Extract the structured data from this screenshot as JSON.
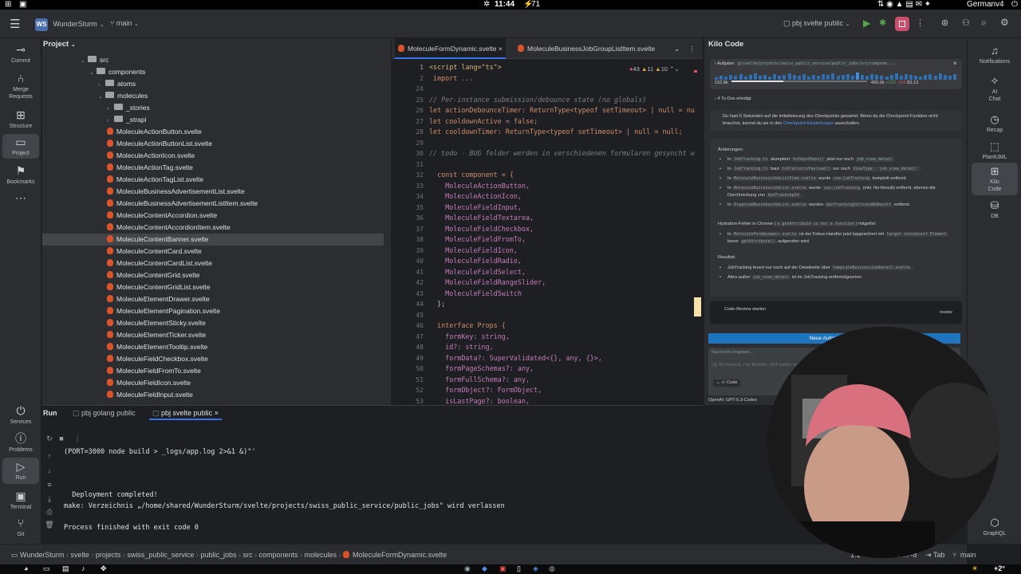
{
  "system_bar": {
    "time": "11:44",
    "battery": "71",
    "keyboard": "German",
    "input_version": "v4"
  },
  "header": {
    "project_tile": "WS",
    "project_name": "WunderSturm",
    "branch": "main",
    "run_config": "pbj svelte public"
  },
  "left_strip": [
    {
      "label": "Commit",
      "icon": "commit-icon"
    },
    {
      "label": "Merge Requests",
      "icon": "merge-request-icon"
    },
    {
      "label": "Structure",
      "icon": "structure-icon"
    },
    {
      "label": "Project",
      "icon": "folder-icon"
    },
    {
      "label": "Bookmarks",
      "icon": "bookmark-icon"
    }
  ],
  "left_bottom_strip": [
    {
      "label": "Services",
      "icon": "services-icon"
    },
    {
      "label": "Problems",
      "icon": "problems-icon"
    },
    {
      "label": "Run",
      "icon": "run-icon"
    },
    {
      "label": "Terminal",
      "icon": "terminal-icon"
    },
    {
      "label": "Git",
      "icon": "git-icon"
    }
  ],
  "project_panel": {
    "title": "Project",
    "tree": [
      {
        "label": "src",
        "type": "folder",
        "depth": 0,
        "expanded": true
      },
      {
        "label": "components",
        "type": "folder",
        "depth": 1,
        "expanded": true
      },
      {
        "label": "atoms",
        "type": "folder",
        "depth": 2,
        "expanded": false
      },
      {
        "label": "molecules",
        "type": "folder",
        "depth": 2,
        "expanded": true
      },
      {
        "label": "_stories",
        "type": "folder",
        "depth": 3,
        "expanded": false
      },
      {
        "label": "_strapi",
        "type": "folder",
        "depth": 3,
        "expanded": false
      },
      {
        "label": "MoleculeActionButton.svelte",
        "type": "file",
        "depth": 3
      },
      {
        "label": "MoleculeActionButtonList.svelte",
        "type": "file",
        "depth": 3
      },
      {
        "label": "MoleculeActionIcon.svelte",
        "type": "file",
        "depth": 3
      },
      {
        "label": "MoleculeActionTag.svelte",
        "type": "file",
        "depth": 3
      },
      {
        "label": "MoleculeActionTagList.svelte",
        "type": "file",
        "depth": 3
      },
      {
        "label": "MoleculeBusinessAdvertisementList.svelte",
        "type": "file",
        "depth": 3
      },
      {
        "label": "MoleculeBusinessAdvertisementListItem.svelte",
        "type": "file",
        "depth": 3
      },
      {
        "label": "MoleculeContentAccordion.svelte",
        "type": "file",
        "depth": 3
      },
      {
        "label": "MoleculeContentAccordionItem.svelte",
        "type": "file",
        "depth": 3
      },
      {
        "label": "MoleculeContentBanner.svelte",
        "type": "file",
        "depth": 3,
        "selected": true
      },
      {
        "label": "MoleculeContentCard.svelte",
        "type": "file",
        "depth": 3
      },
      {
        "label": "MoleculeContentCardList.svelte",
        "type": "file",
        "depth": 3
      },
      {
        "label": "MoleculeContentGrid.svelte",
        "type": "file",
        "depth": 3
      },
      {
        "label": "MoleculeContentGridList.svelte",
        "type": "file",
        "depth": 3
      },
      {
        "label": "MoleculeElementDrawer.svelte",
        "type": "file",
        "depth": 3
      },
      {
        "label": "MoleculeElementPagination.svelte",
        "type": "file",
        "depth": 3
      },
      {
        "label": "MoleculeElementSticky.svelte",
        "type": "file",
        "depth": 3
      },
      {
        "label": "MoleculeElementTicker.svelte",
        "type": "file",
        "depth": 3
      },
      {
        "label": "MoleculeElementTooltip.svelte",
        "type": "file",
        "depth": 3
      },
      {
        "label": "MoleculeFieldCheckbox.svelte",
        "type": "file",
        "depth": 3
      },
      {
        "label": "MoleculeFieldFromTo.svelte",
        "type": "file",
        "depth": 3
      },
      {
        "label": "MoleculeFieldIcon.svelte",
        "type": "file",
        "depth": 3
      },
      {
        "label": "MoleculeFieldInput.svelte",
        "type": "file",
        "depth": 3
      }
    ]
  },
  "editor": {
    "tabs": [
      {
        "label": "MoleculeFormDynamic.svelte",
        "active": true
      },
      {
        "label": "MoleculeBusinessJobGroupListItem.svelte",
        "active": false
      }
    ],
    "inspections": {
      "errors": "43",
      "warnings": "11",
      "weak": "10"
    },
    "lines": [
      {
        "n": "1",
        "text": "<script lang=\"ts\">"
      },
      {
        "n": "2",
        "text": " import ..."
      },
      {
        "n": "24",
        "text": ""
      },
      {
        "n": "25",
        "text": "// Per-instance submission/debounce state (no globals)"
      },
      {
        "n": "26",
        "text": "let actionDebounceTimer: ReturnType<typeof setTimeout> | null = null"
      },
      {
        "n": "27",
        "text": "let cooldownActive = false;"
      },
      {
        "n": "28",
        "text": "let cooldownTimer: ReturnType<typeof setTimeout> | null = null;"
      },
      {
        "n": "29",
        "text": ""
      },
      {
        "n": "30",
        "text": "// todo - BUG felder werden in verschiedenen formularen gesyncht wenn"
      },
      {
        "n": "31",
        "text": ""
      },
      {
        "n": "32",
        "text": "  const component = {"
      },
      {
        "n": "33",
        "text": "    MoleculeActionButton,"
      },
      {
        "n": "34",
        "text": "    MoleculeActionIcon,"
      },
      {
        "n": "35",
        "text": "    MoleculeFieldInput,"
      },
      {
        "n": "36",
        "text": "    MoleculeFieldTextarea,"
      },
      {
        "n": "37",
        "text": "    MoleculeFieldCheckbox,"
      },
      {
        "n": "38",
        "text": "    MoleculeFieldFromTo,"
      },
      {
        "n": "39",
        "text": "    MoleculeFieldIcon,"
      },
      {
        "n": "40",
        "text": "    MoleculeFieldRadio,"
      },
      {
        "n": "41",
        "text": "    MoleculeFieldSelect,"
      },
      {
        "n": "42",
        "text": "    MoleculeFieldRangeSlider,"
      },
      {
        "n": "43",
        "text": "    MoleculeFieldSwitch"
      },
      {
        "n": "44",
        "text": "  };"
      },
      {
        "n": "45",
        "text": ""
      },
      {
        "n": "46",
        "text": "  interface Props {"
      },
      {
        "n": "47",
        "text": "    formKey: string,"
      },
      {
        "n": "48",
        "text": "    id?: string,"
      },
      {
        "n": "49",
        "text": "    formData?: SuperValidated<{}, any, {}>,"
      },
      {
        "n": "50",
        "text": "    formPageSchemas?: any,"
      },
      {
        "n": "51",
        "text": "    formFullSchema?: any,"
      },
      {
        "n": "52",
        "text": "    formObject?: FormObject,"
      },
      {
        "n": "53",
        "text": "    isLastPage?: boolean,"
      }
    ]
  },
  "kilo": {
    "title": "Kilo Code",
    "task_label": "Aufgabe:",
    "task_path": "@/svelte/projects/swiss_public_service/public_jobs/src/compone...",
    "stats": {
      "left": "152.8k",
      "ctx": "400.0k",
      "plus": "+220",
      "minus": "-124",
      "cost": "$3.13"
    },
    "todos": "4 To-Dos erledigt",
    "checkpoint_a": "Du hast 5 Sekunden auf die Initialisierung des Checkpoints gewartet. Wenn du die Checkpoint-Funktion nicht brauchst, kannst du sie in den",
    "checkpoint_link": "Checkpoint-Einstellungen",
    "checkpoint_b": "ausschalten.",
    "changes_title": "Änderungen:",
    "changes": [
      {
        "pre": "In",
        "code": "JobTracking.ts",
        "mid": "akzeptiert",
        "code2": "toInputData()",
        "post": "jetzt nur noch",
        "code3": "job_view_detail",
        "end": "."
      },
      {
        "pre": "In",
        "code": "JobTracking.ts",
        "mid": "baut",
        "code2": "toStatisticPayload()",
        "post": "nur noch",
        "code3": "ViewType: 'job_view_detail'",
        "end": "."
      },
      {
        "pre": "In",
        "code": "MoleculeBusinessJobListItem.svelte",
        "mid": "wurde",
        "code2": "use:jobTracking",
        "post": "komplett entfernt.",
        "code3": "",
        "end": ""
      },
      {
        "pre": "In",
        "code": "MoleculeBusinessJobList.svelte",
        "mid": "wurde",
        "code2": "use:jobTracking",
        "post": "(inkl. No-Result) entfernt, ebenso die Durchreichung von",
        "code3": "dynTrackingId",
        "end": "."
      },
      {
        "pre": "In",
        "code": "OrganismBusinessJobList.svelte",
        "mid": "wurden",
        "code2": "dynTrackingId/trackNoResult",
        "post": "entfernt.",
        "code3": "",
        "end": ""
      }
    ],
    "hydration_title": "Hydration-Fehler in Chrome (",
    "hydration_code": "e.getAttribute is not a function",
    "hydration_end": ") mitgefixt:",
    "hydration_item": {
      "pre": "In",
      "code": "MoleculeFormDynamic.svelte",
      "mid": "ist der Fokus-Handler jetzt typgesichert mit",
      "code2": "target instanceof Element",
      "post": "bevor",
      "code3": "getAttribute()",
      "end": "aufgerufen wird."
    },
    "result_title": "Resultat:",
    "results": [
      {
        "pre": "JobTracking feuert nur noch auf der Detailseite über",
        "code": "templateBusinessJobDetail.svelte",
        "end": "."
      },
      {
        "pre": "Alles außer",
        "code": "job_view_detail",
        "end": "ist im JobTracking entfernt/ignoriert."
      }
    ],
    "review_label": "Code-Review starten",
    "review_cmd": "/review",
    "new_task": "Neue Aufgabe starten",
    "input_placeholder": "Nachricht eingeben...",
    "input_hint": "(@ für Kontext, / für Befehle, Shift halten um Dateien",
    "mode_label": "Code",
    "model": "OpenAI: GPT-5.3-Codex"
  },
  "right_strip": [
    {
      "label": "Notifications",
      "icon": "bell-icon"
    },
    {
      "label": "AI Chat",
      "icon": "ai-chat-icon"
    },
    {
      "label": "Recap",
      "icon": "recap-icon"
    },
    {
      "label": "PlantUML",
      "icon": "plantuml-icon"
    },
    {
      "label": "Kilo Code",
      "icon": "kilo-icon",
      "active": true
    },
    {
      "label": "DB",
      "icon": "database-icon"
    },
    {
      "label": "GraphQL",
      "icon": "graphql-icon"
    }
  ],
  "run_panel": {
    "title": "Run",
    "tabs": [
      {
        "label": "pbj golang public",
        "active": false
      },
      {
        "label": "pbj svelte public",
        "active": true
      }
    ],
    "output": [
      "(PORT=3000 node build > _logs/app.log 2>&1 &)\"'",
      "",
      "",
      "",
      "  Deployment completed!",
      "make: Verzeichnis „/home/shared/WunderSturm/svelte/projects/swiss_public_service/public_jobs\" wird verlassen",
      "",
      "Process finished with exit code 0"
    ]
  },
  "status_bar": {
    "breadcrumb": [
      "WunderSturm",
      "svelte",
      "projects",
      "swiss_public_service",
      "public_jobs",
      "src",
      "components",
      "molecules",
      "MoleculeFormDynamic.svelte"
    ],
    "position": "1:1",
    "line_sep": "LF",
    "encoding": "UTF-8",
    "indent": "Tab",
    "branch": "main"
  },
  "taskbar": {
    "temperature": "+2°"
  },
  "colors": {
    "accent": "#3574f0",
    "svelte": "#d9532c",
    "bg": "#1e1f22",
    "panel": "#2b2d30",
    "kilo_button": "#1e75be"
  }
}
